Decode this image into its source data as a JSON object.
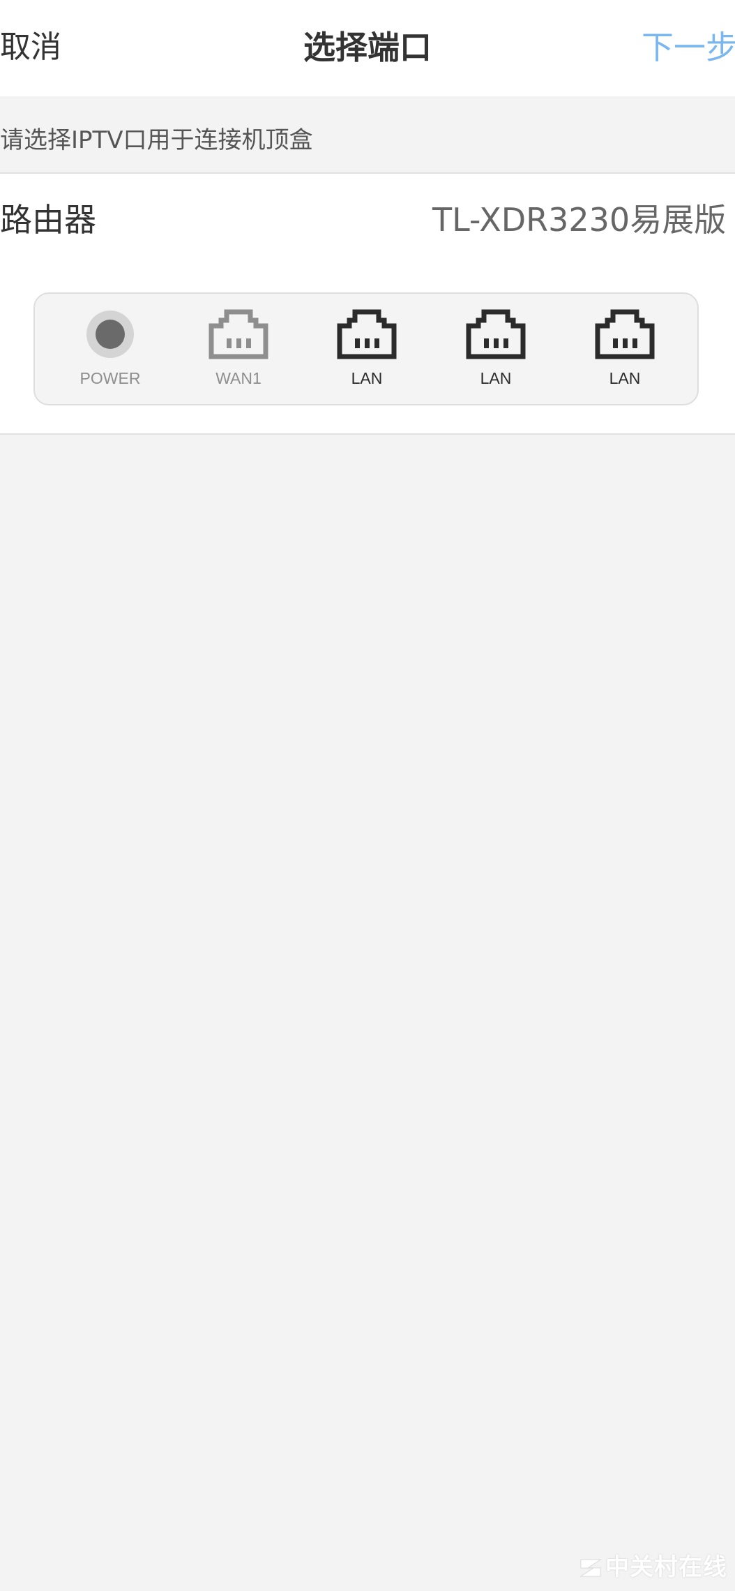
{
  "nav": {
    "cancel_label": "取消",
    "title": "选择端口",
    "next_label": "下一步",
    "next_color": "#7ab7ef"
  },
  "hint": "请选择IPTV口用于连接机顶盒",
  "router": {
    "label": "路由器",
    "model": "TL-XDR3230易展版"
  },
  "ports": [
    {
      "name": "POWER",
      "icon": "power-indicator-icon",
      "state": "inactive",
      "color": "#8e8e8e"
    },
    {
      "name": "WAN1",
      "icon": "ethernet-port-icon",
      "state": "disabled",
      "color": "#8e8e8e"
    },
    {
      "name": "LAN",
      "icon": "ethernet-port-icon",
      "state": "selectable",
      "color": "#2b2b2b"
    },
    {
      "name": "LAN",
      "icon": "ethernet-port-icon",
      "state": "selectable",
      "color": "#2b2b2b"
    },
    {
      "name": "LAN",
      "icon": "ethernet-port-icon",
      "state": "selectable",
      "color": "#2b2b2b"
    }
  ],
  "watermark": {
    "text": "中关村在线"
  }
}
